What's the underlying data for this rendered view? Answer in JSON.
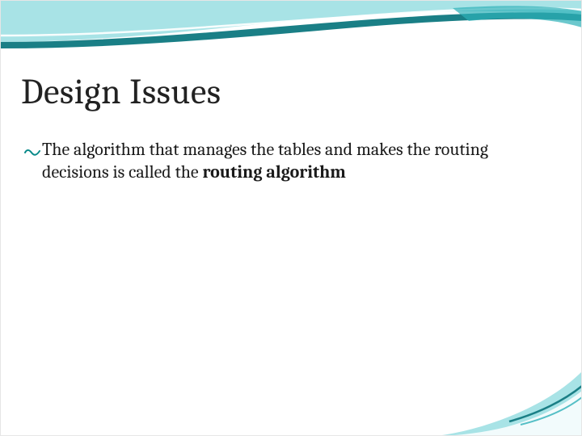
{
  "slide": {
    "title": "Design Issues",
    "bullet": {
      "text_before": "The algorithm that manages the tables and makes the routing decisions is called the ",
      "bold_term": "routing algorithm"
    }
  },
  "theme": {
    "accent": "#2db0b8",
    "accent_dark": "#1a7f86",
    "accent_light": "#a8e3e6",
    "white": "#ffffff"
  }
}
